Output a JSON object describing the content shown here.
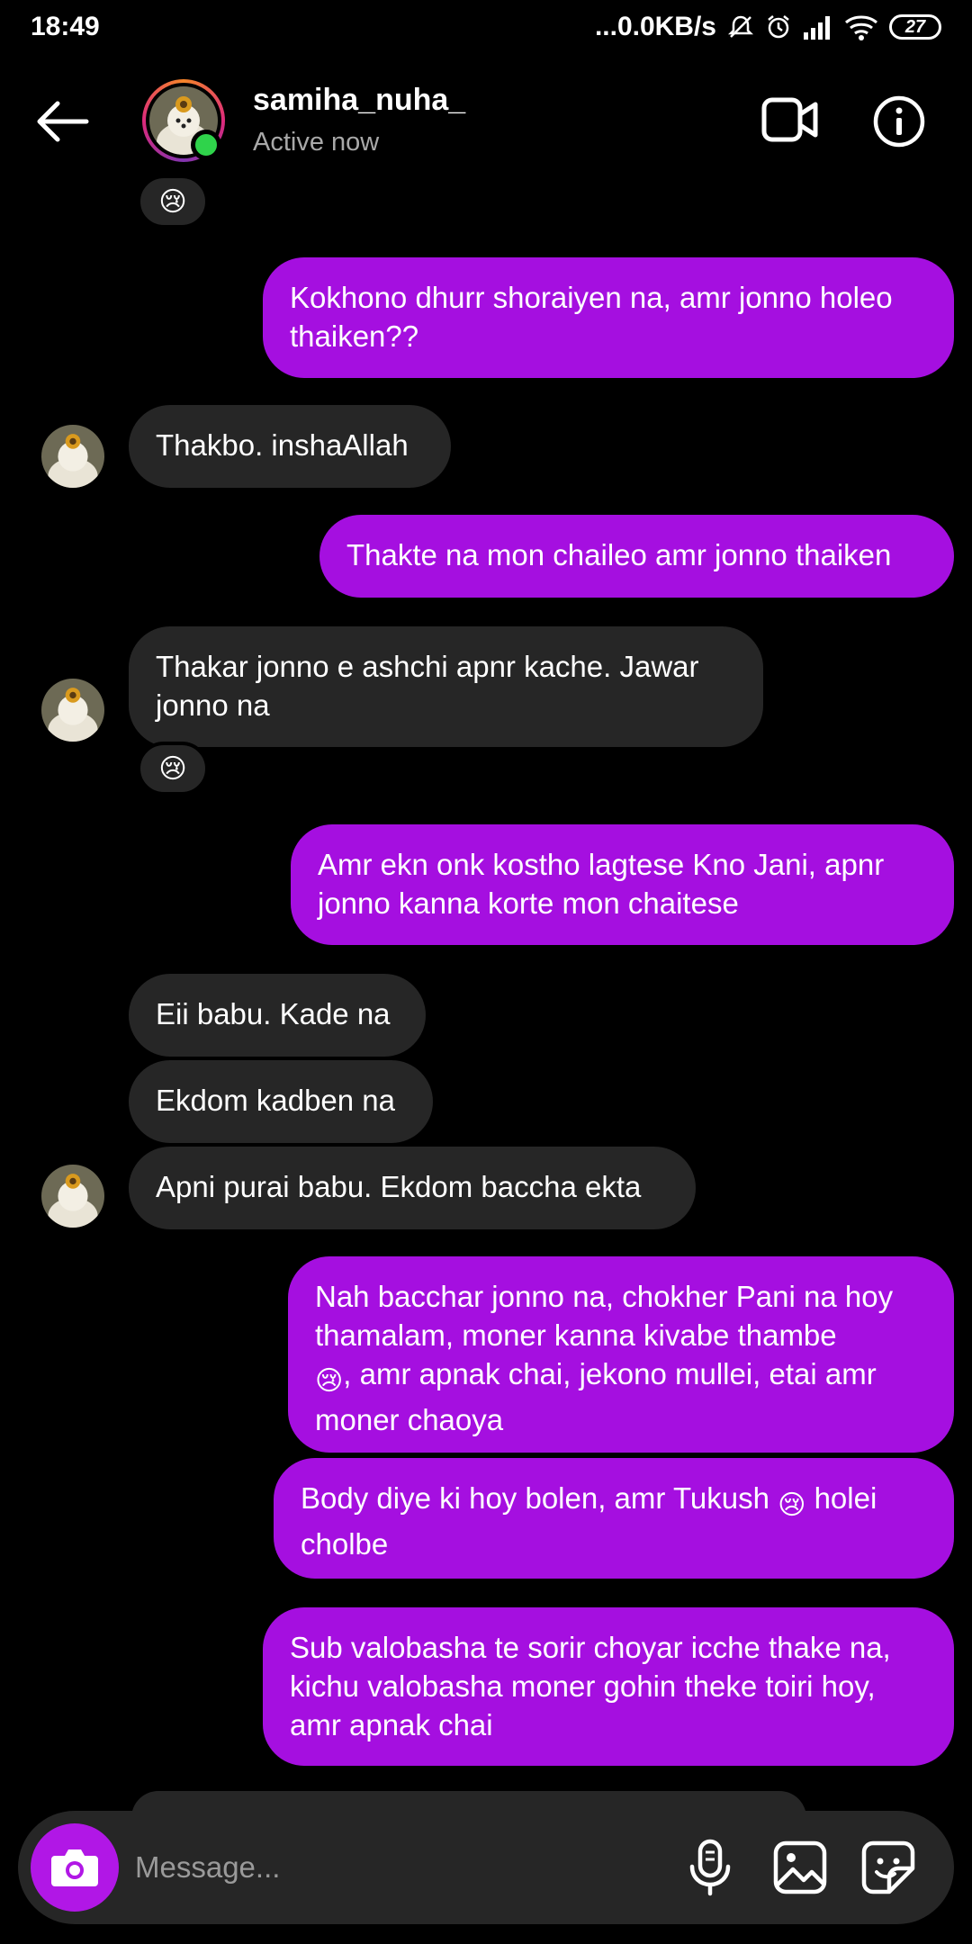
{
  "status_bar": {
    "time": "18:49",
    "network_speed": "...0.0KB/s",
    "battery": "27",
    "icons": [
      "mute-bell-icon",
      "alarm-icon",
      "signal-icon",
      "wifi-icon",
      "battery-icon"
    ]
  },
  "header": {
    "username": "samiha_nuha_",
    "status": "Active now",
    "icons": [
      "back-arrow-icon",
      "video-call-icon",
      "info-icon"
    ]
  },
  "messages": [
    {
      "side": "in",
      "text": "",
      "reaction": "😢"
    },
    {
      "side": "out",
      "line1": "Kokhono dhurr shoraiyen na, amr jonno holeo",
      "line2": "thaiken??"
    },
    {
      "side": "in",
      "text": "Thakbo. inshaAllah"
    },
    {
      "side": "out",
      "text": "Thakte na mon chaileo amr jonno thaiken"
    },
    {
      "side": "in",
      "line1": "Thakar jonno e ashchi apnr kache. Jawar",
      "line2": "jonno na",
      "reaction": "😢"
    },
    {
      "side": "out",
      "line1": "Amr ekn onk kostho lagtese Kno Jani, apnr",
      "line2": "jonno kanna korte mon chaitese"
    },
    {
      "side": "in",
      "text": "Eii babu. Kade na"
    },
    {
      "side": "in",
      "text": "Ekdom kadben na"
    },
    {
      "side": "in",
      "text": "Apni purai babu. Ekdom baccha ekta"
    },
    {
      "side": "out",
      "line1": "Nah bacchar jonno na, chokher Pani na hoy",
      "line2": "thamalam, moner kanna kivabe thambe",
      "line3": ", amr apnak chai, jekono mullei, etai amr",
      "line4": "moner chaoya"
    },
    {
      "side": "out",
      "line1a": "Body diye ki hoy bolen, amr Tukush",
      "line1b": "holei",
      "line2": "cholbe"
    },
    {
      "side": "out",
      "line1": "Sub valobasha te sorir choyar icche thake na,",
      "line2": "kichu valobasha moner gohin theke toiri hoy,",
      "line3": "amr apnak chai"
    }
  ],
  "composer": {
    "placeholder": "Message...",
    "icons": [
      "camera-icon",
      "microphone-icon",
      "gallery-icon",
      "sticker-icon"
    ]
  },
  "colors": {
    "background": "#000000",
    "incoming_bubble": "#262626",
    "outgoing_bubble": "#a50fe0",
    "camera_button": "#b117e6",
    "online_dot": "#2fd34b"
  }
}
